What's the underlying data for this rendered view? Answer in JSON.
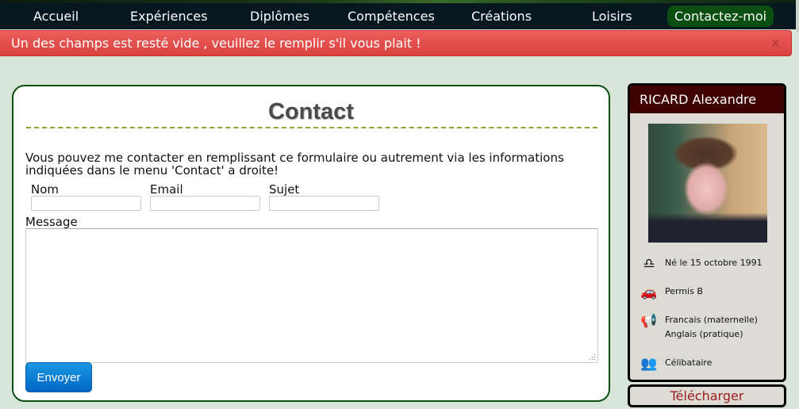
{
  "nav": {
    "items": [
      {
        "label": "Accueil",
        "active": false
      },
      {
        "label": "Expériences",
        "active": false
      },
      {
        "label": "Diplômes",
        "active": false
      },
      {
        "label": "Compétences",
        "active": false
      },
      {
        "label": "Créations",
        "active": false
      },
      {
        "label": "Loisirs",
        "active": false
      },
      {
        "label": "Contactez-moi",
        "active": true
      }
    ]
  },
  "alert": {
    "message": "Un des champs est resté vide , veuillez le remplir s'il vous plait !",
    "close_label": "x"
  },
  "contact": {
    "title": "Contact",
    "intro": "Vous pouvez me contacter en remplissant ce formulaire ou autrement via les informations indiquées dans le menu 'Contact' a droite!",
    "fields": [
      {
        "label": "Nom",
        "value": ""
      },
      {
        "label": "Email",
        "value": ""
      },
      {
        "label": "Sujet",
        "value": ""
      }
    ],
    "message_label": "Message",
    "message_value": "",
    "submit_label": "Envoyer"
  },
  "profile": {
    "name": "RICARD Alexandre",
    "info": [
      {
        "icon": "libra-icon",
        "glyph": "♎",
        "lines": [
          "Né le 15 octobre 1991"
        ]
      },
      {
        "icon": "car-icon",
        "glyph": "🚗",
        "lines": [
          "Permis B"
        ]
      },
      {
        "icon": "megaphone-icon",
        "glyph": "📢",
        "lines": [
          "Francais (maternelle)",
          "Anglais (pratique)"
        ]
      },
      {
        "icon": "people-icon",
        "glyph": "👥",
        "lines": [
          "Célibataire"
        ]
      }
    ],
    "download_label": "Télécharger"
  },
  "colors": {
    "nav_active": "#0b4f10",
    "alert": "#e05350",
    "card_border": "#0b4f10",
    "profile_header": "#3f0000",
    "download_text": "#9b1c1c",
    "submit": "#0f7fd5"
  }
}
